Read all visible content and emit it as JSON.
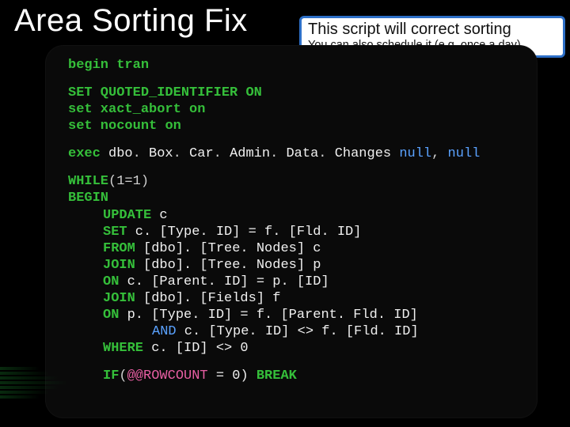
{
  "title": "Area Sorting Fix",
  "callout": {
    "title": "This script will correct sorting",
    "sub": "You can also schedule it (e.g. once a day)"
  },
  "code": {
    "l1_a": "begin",
    "l1_b": " tran",
    "l2_a": "SET",
    "l2_b": " QUOTED_IDENTIFIER ",
    "l2_c": "ON",
    "l3_a": "set",
    "l3_b": " xact_abort ",
    "l3_c": "on",
    "l4_a": "set",
    "l4_b": " nocount ",
    "l4_c": "on",
    "l5_a": "exec ",
    "l5_b": "dbo",
    "l5_c": ". ",
    "l5_d": "Box",
    "l5_e": ". ",
    "l5_f": "Car",
    "l5_g": ". ",
    "l5_h": "Admin",
    "l5_i": ". ",
    "l5_j": "Data",
    "l5_k": ". ",
    "l5_l": "Changes ",
    "l5_m": "null",
    "l5_n": ", ",
    "l5_o": "null",
    "l6_a": "WHILE",
    "l6_b": "(1=1)",
    "l7": "BEGIN",
    "l8_a": "UPDATE",
    "l8_b": " c",
    "l9_a": "SET",
    "l9_b": " c. [Type. ID] = f. [Fld. ID]",
    "l10_a": "FROM",
    "l10_b": " [dbo]. [Tree. Nodes] c",
    "l11_a": "JOIN",
    "l11_b": " [dbo]. [Tree. Nodes] p",
    "l12_a": "ON",
    "l12_b": " c. [Parent. ID] = p. [ID]",
    "l13_a": "JOIN",
    "l13_b": " [dbo]. [Fields] f",
    "l14_a": "ON",
    "l14_b": " p. [Type. ID] = f. [Parent. Fld. ID]",
    "l15_a": "AND",
    "l15_b": " c. [Type. ID] <> f. [Fld. ID]",
    "l16_a": "WHERE",
    "l16_b": " c. [ID] <> 0",
    "l17_a": "IF",
    "l17_b": "(",
    "l17_c": "@@ROWCOUNT",
    "l17_d": " = 0) ",
    "l17_e": "BREAK"
  }
}
